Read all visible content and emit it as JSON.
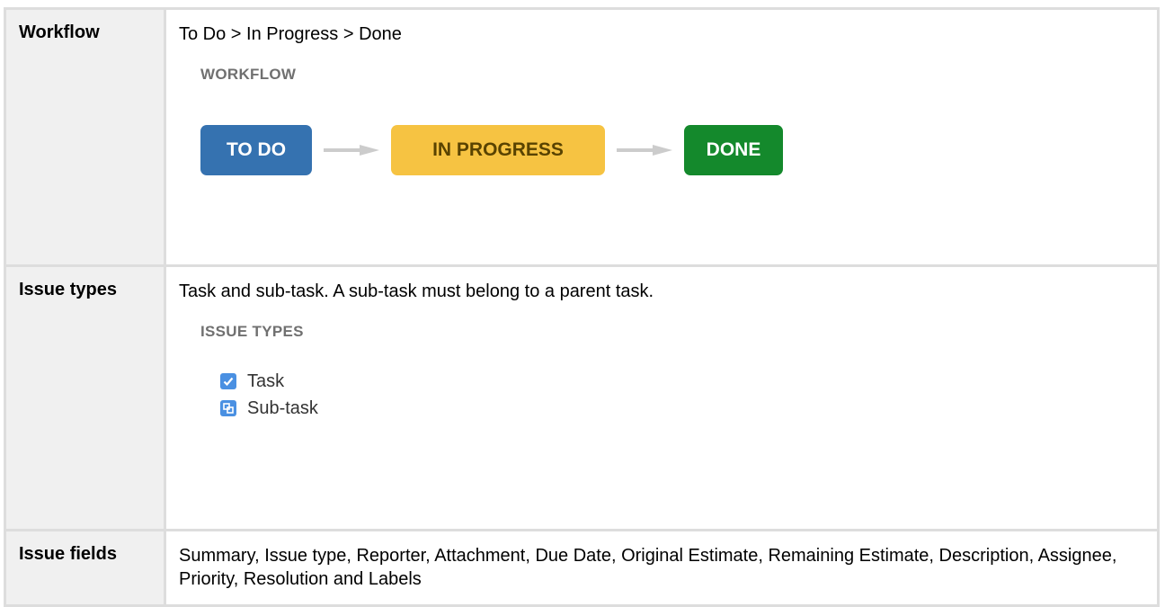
{
  "rows": {
    "workflow": {
      "label": "Workflow",
      "description": "To Do > In Progress > Done",
      "section_title": "WORKFLOW",
      "statuses": [
        {
          "label": "TO DO",
          "color": "#3572b0"
        },
        {
          "label": "IN PROGRESS",
          "color": "#f6c342"
        },
        {
          "label": "DONE",
          "color": "#14892c"
        }
      ],
      "arrow_icon": "arrow-right-icon"
    },
    "issue_types": {
      "label": "Issue types",
      "description": "Task and sub-task. A sub-task must belong to a parent task.",
      "section_title": "ISSUE TYPES",
      "types": [
        {
          "label": "Task",
          "icon": "task-checkbox-icon"
        },
        {
          "label": "Sub-task",
          "icon": "subtask-icon"
        }
      ]
    },
    "issue_fields": {
      "label": "Issue fields",
      "description": "Summary, Issue type, Reporter, Attachment, Due Date, Original Estimate, Remaining Estimate, Description, Assignee, Priority, Resolution and Labels"
    }
  }
}
